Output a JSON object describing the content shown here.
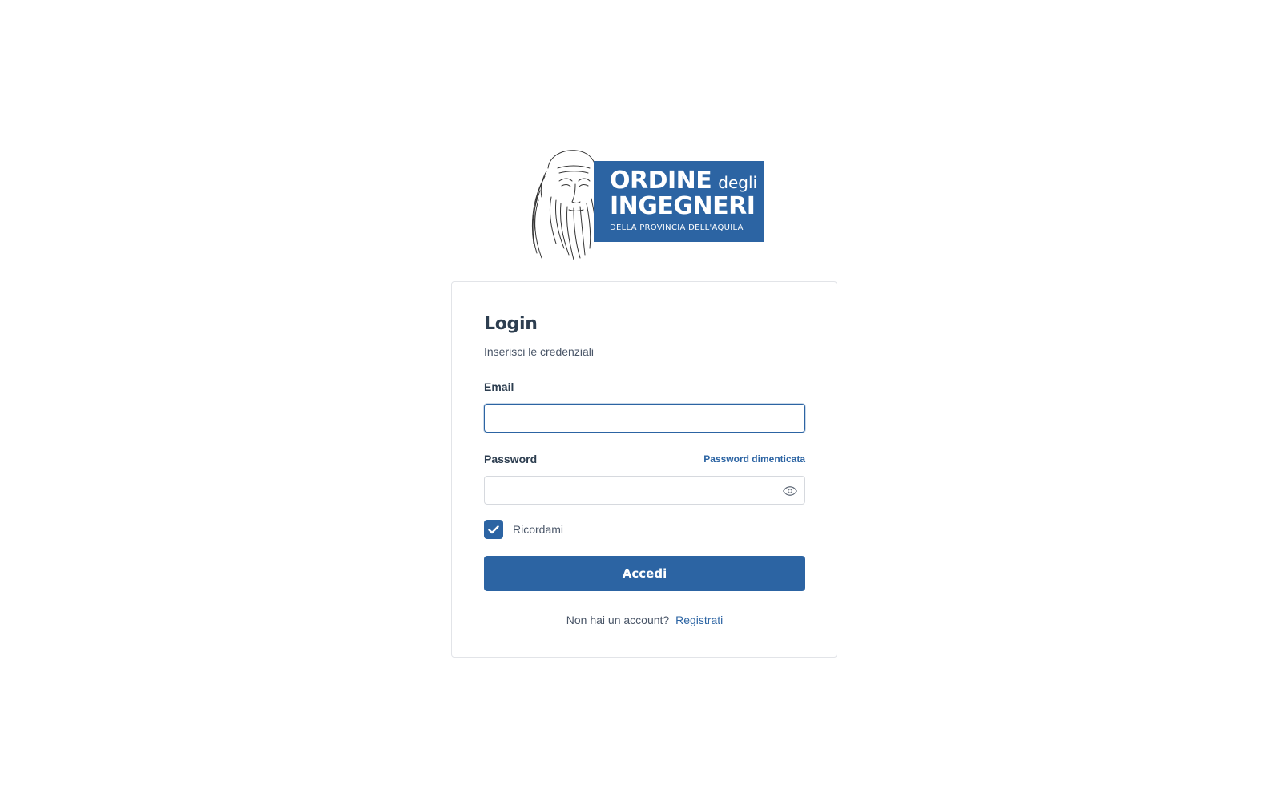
{
  "logo": {
    "line1_bold": "ORDINE",
    "line1_small": "degli",
    "line2": "INGEGNERI",
    "line3": "DELLA PROVINCIA DELL'AQUILA",
    "banner_color": "#2c64a3"
  },
  "login": {
    "title": "Login",
    "subtitle": "Inserisci le credenziali",
    "email_label": "Email",
    "email_value": "",
    "password_label": "Password",
    "password_value": "",
    "forgot_password": "Password dimenticata",
    "remember_label": "Ricordami",
    "remember_checked": true,
    "submit_label": "Accedi",
    "no_account_text": "Non hai un account?",
    "register_link": "Registrati"
  },
  "icons": {
    "show_password": "eye-icon",
    "checkbox_mark": "check-icon"
  },
  "colors": {
    "primary": "#2c64a3",
    "text_dark": "#2d3e50",
    "text_muted": "#4a5668",
    "border": "#d6d9de"
  }
}
